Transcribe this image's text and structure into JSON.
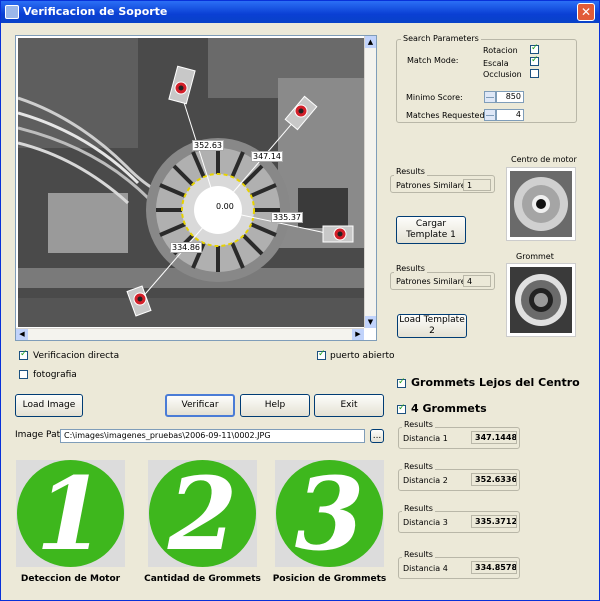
{
  "window": {
    "title": "Verificacion de Soporte",
    "close": "✕"
  },
  "image_view": {
    "measurements": {
      "top": "352.63",
      "top_right": "347.14",
      "center": "0.00",
      "right": "335.37",
      "bottom_left": "334.86"
    }
  },
  "options": {
    "verificacion_directa": {
      "label": "Verificacion directa",
      "checked": true
    },
    "fotografia": {
      "label": "fotografia",
      "checked": false
    },
    "puerto_abierto": {
      "label": "puerto abierto",
      "checked": true
    }
  },
  "buttons": {
    "load_image": "Load Image",
    "verificar": "Verificar",
    "help": "Help",
    "exit": "Exit",
    "browse": "..."
  },
  "image_path": {
    "label": "Image Path",
    "value": "C:\\images\\imagenes_pruebas\\2006-09-11\\0002.JPG"
  },
  "steps": [
    {
      "digit": "1",
      "caption": "Deteccion de Motor"
    },
    {
      "digit": "2",
      "caption": "Cantidad de Grommets"
    },
    {
      "digit": "3",
      "caption": "Posicion de Grommets"
    }
  ],
  "search_params": {
    "title": "Search Parameters",
    "match_mode_label": "Match Mode:",
    "rotacion": {
      "label": "Rotacion",
      "checked": true
    },
    "escala": {
      "label": "Escala",
      "checked": true
    },
    "occlusion": {
      "label": "Occlusion",
      "checked": false
    },
    "minimo_score_label": "Minimo Score:",
    "minimo_score_value": "850",
    "matches_label": "Matches Requested:",
    "matches_value": "4"
  },
  "results1": {
    "title": "Results",
    "label": "Patrones Similares:",
    "value": "1"
  },
  "results2": {
    "title": "Results",
    "label": "Patrones Similares:",
    "value": "4"
  },
  "cargar_template": "Cargar Template 1",
  "load_template2": "Load Template 2",
  "centro_label": "Centro de motor",
  "grommet_label": "Grommet",
  "checks_right": {
    "lejos": {
      "label": "Grommets Lejos del Centro",
      "checked": true
    },
    "cuatro": {
      "label": "4 Grommets",
      "checked": true
    }
  },
  "distances": [
    {
      "title": "Results",
      "label": "Distancia 1",
      "value": "347.1448"
    },
    {
      "title": "Results",
      "label": "Distancia 2",
      "value": "352.6336"
    },
    {
      "title": "Results",
      "label": "Distancia 3",
      "value": "335.3712"
    },
    {
      "title": "Results",
      "label": "Distancia 4",
      "value": "334.8578"
    }
  ],
  "colors": {
    "title_blue": "#0a3fd4",
    "step_green": "#3eb71d",
    "grommet_red": "#d3202a"
  }
}
